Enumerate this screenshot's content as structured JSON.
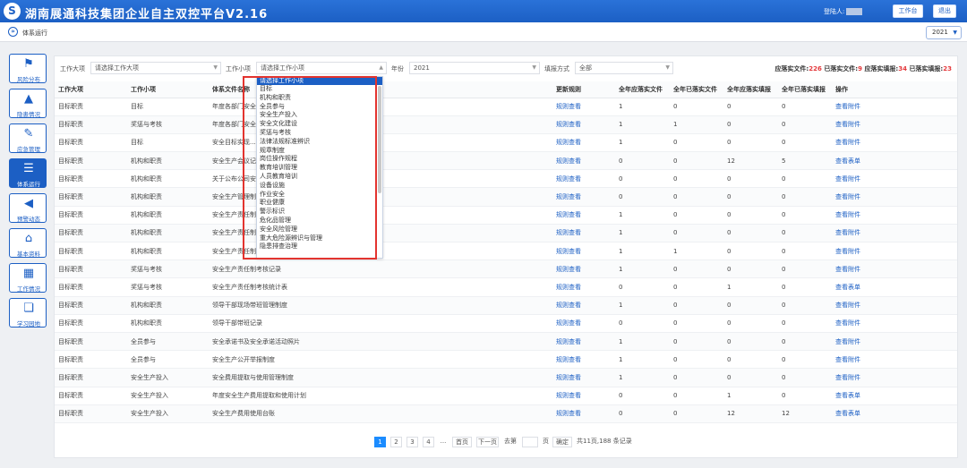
{
  "header": {
    "logo_glyph": "S",
    "title": "湖南展通科技集团企业自主双控平台V2.16",
    "user_label": "登陆人:",
    "workbench_button": "工作台",
    "logout_button": "退出"
  },
  "breadcrumb": {
    "icon": "»",
    "label": "体系运行"
  },
  "year_select": {
    "value": "2021"
  },
  "sidebar": {
    "items": [
      {
        "icon": "⚑",
        "label": "风险分布"
      },
      {
        "icon": "▲",
        "label": "隐患情况"
      },
      {
        "icon": "✎",
        "label": "应急管理"
      },
      {
        "icon": "☰",
        "label": "体系运行"
      },
      {
        "icon": "📢",
        "label": "预警动态"
      },
      {
        "icon": "⌂",
        "label": "基本资料"
      },
      {
        "icon": "▦",
        "label": "工作情况"
      },
      {
        "icon": "📖",
        "label": "学习园地"
      }
    ]
  },
  "filters": {
    "work_category_label": "工作大项",
    "work_category_placeholder": "请选择工作大项",
    "work_item_label": "工作小项",
    "work_item_placeholder": "请选择工作小项",
    "year_label": "年份",
    "year_value": "2021",
    "fill_method_label": "填报方式",
    "fill_method_value": "全部"
  },
  "stats": {
    "should_files_label": "应落实文件:",
    "should_files": "226",
    "done_files_label": "已落实文件:",
    "done_files": "9",
    "should_reports_label": "应落实填报:",
    "should_reports": "34",
    "done_reports_label": "已落实填报:",
    "done_reports": "23"
  },
  "table": {
    "headers": [
      "工作大项",
      "工作小项",
      "体系文件名称",
      "更新规则",
      "全年应落实文件",
      "全年已落实文件",
      "全年应落实填报",
      "全年已落实填报",
      "操作"
    ],
    "rows": [
      [
        "目标职责",
        "目标",
        "年度各部门安全...",
        "规则查看",
        "1",
        "0",
        "0",
        "0",
        "查看附件"
      ],
      [
        "目标职责",
        "奖惩与考核",
        "年度各部门安全...",
        "规则查看",
        "1",
        "1",
        "0",
        "0",
        "查看附件"
      ],
      [
        "目标职责",
        "目标",
        "安全目标实现...",
        "规则查看",
        "1",
        "0",
        "0",
        "0",
        "查看附件"
      ],
      [
        "目标职责",
        "机构和职责",
        "安全生产会议记...",
        "规则查看",
        "0",
        "0",
        "12",
        "5",
        "查看表单"
      ],
      [
        "目标职责",
        "机构和职责",
        "关于公布公司安全...",
        "规则查看",
        "0",
        "0",
        "0",
        "0",
        "查看附件"
      ],
      [
        "目标职责",
        "机构和职责",
        "安全生产管理制...",
        "规则查看",
        "0",
        "0",
        "0",
        "0",
        "查看附件"
      ],
      [
        "目标职责",
        "机构和职责",
        "安全生产责任制...",
        "规则查看",
        "1",
        "0",
        "0",
        "0",
        "查看附件"
      ],
      [
        "目标职责",
        "机构和职责",
        "安全生产责任制...",
        "规则查看",
        "1",
        "0",
        "0",
        "0",
        "查看附件"
      ],
      [
        "目标职责",
        "机构和职责",
        "安全生产责任制...",
        "规则查看",
        "1",
        "1",
        "0",
        "0",
        "查看附件"
      ],
      [
        "目标职责",
        "奖惩与考核",
        "安全生产责任制考核记录",
        "规则查看",
        "1",
        "0",
        "0",
        "0",
        "查看附件"
      ],
      [
        "目标职责",
        "奖惩与考核",
        "安全生产责任制考核统计表",
        "规则查看",
        "0",
        "0",
        "1",
        "0",
        "查看表单"
      ],
      [
        "目标职责",
        "机构和职责",
        "领导干部现场带班管理制度",
        "规则查看",
        "1",
        "0",
        "0",
        "0",
        "查看附件"
      ],
      [
        "目标职责",
        "机构和职责",
        "领导干部带班记录",
        "规则查看",
        "0",
        "0",
        "0",
        "0",
        "查看附件"
      ],
      [
        "目标职责",
        "全员参与",
        "安全承诺书及安全承诺活动照片",
        "规则查看",
        "1",
        "0",
        "0",
        "0",
        "查看附件"
      ],
      [
        "目标职责",
        "全员参与",
        "安全生产公开举报制度",
        "规则查看",
        "1",
        "0",
        "0",
        "0",
        "查看附件"
      ],
      [
        "目标职责",
        "安全生产投入",
        "安全费用提取与使用管理制度",
        "规则查看",
        "1",
        "0",
        "0",
        "0",
        "查看附件"
      ],
      [
        "目标职责",
        "安全生产投入",
        "年度安全生产费用提取和使用计划",
        "规则查看",
        "0",
        "0",
        "1",
        "0",
        "查看表单"
      ],
      [
        "目标职责",
        "安全生产投入",
        "安全生产费用使用台账",
        "规则查看",
        "0",
        "0",
        "12",
        "12",
        "查看表单"
      ]
    ]
  },
  "dropdown": {
    "header": "请选择工作小项",
    "options": [
      "目标",
      "机构和职责",
      "全员参与",
      "安全生产投入",
      "安全文化建设",
      "奖惩与考核",
      "法律法规标准辨识",
      "规章制度",
      "岗位操作规程",
      "教育培训管理",
      "人员教育培训",
      "设备设施",
      "作业安全",
      "职业健康",
      "警示标识",
      "危化品管理",
      "安全风险管理",
      "重大危险源辨识与管理",
      "隐患排查治理"
    ]
  },
  "pager": {
    "pages": [
      "1",
      "2",
      "3",
      "4"
    ],
    "ellipsis": "...",
    "first": "首页",
    "next": "下一页",
    "goto_label": "去第",
    "page_unit": "页",
    "confirm": "确定",
    "summary": "共11页,188 条记录"
  },
  "colors": {
    "brand": "#1c5fc4",
    "highlight": "#e4393c"
  }
}
